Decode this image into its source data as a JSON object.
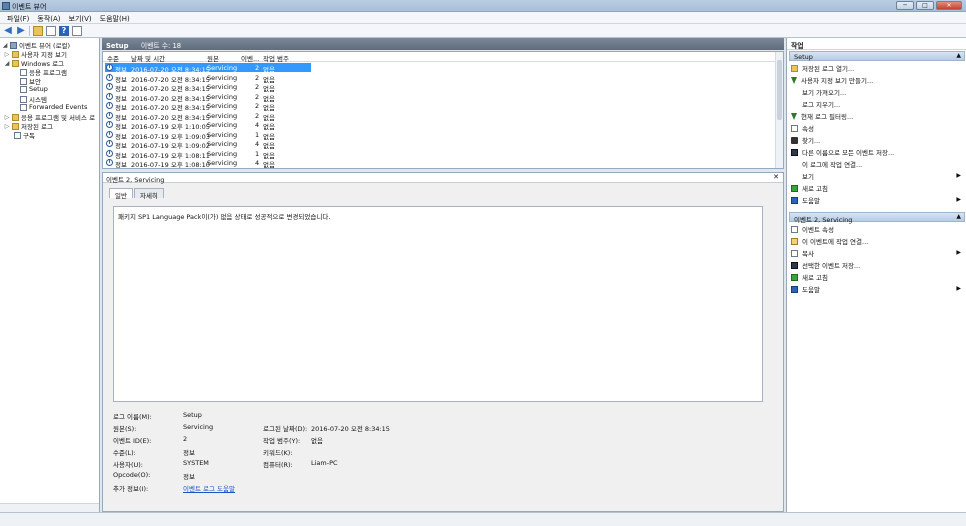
{
  "window": {
    "title": "이벤트 뷰어",
    "minimize": "─",
    "maximize": "□",
    "close": "✕"
  },
  "menu": [
    "파일(F)",
    "동작(A)",
    "보기(V)",
    "도움말(H)"
  ],
  "toolbar": {
    "back": "◀",
    "forward": "▶",
    "help": "?"
  },
  "tree": {
    "root": "이벤트 뷰어 (로컬)",
    "custom_views": "사용자 지정 보기",
    "windows_logs": "Windows 로그",
    "application": "응용 프로그램",
    "security": "보안",
    "setup": "Setup",
    "system": "시스템",
    "forwarded": "Forwarded Events",
    "apps_services": "응용 프로그램 및 서비스 로",
    "saved_logs": "저장된 로그",
    "subscriptions": "구독",
    "expand": "▷",
    "collapse": "◢"
  },
  "center": {
    "log_name": "Setup",
    "event_count": "이벤트 수: 18",
    "columns": [
      "수준",
      "날짜 및 시간",
      "원본",
      "이벤...",
      "작업 범주"
    ],
    "rows": [
      {
        "level": "정보",
        "datetime": "2016-07-20 오전 8:34:15",
        "source": "Servicing",
        "id": "2",
        "category": "없음"
      },
      {
        "level": "정보",
        "datetime": "2016-07-20 오전 8:34:15",
        "source": "Servicing",
        "id": "2",
        "category": "없음"
      },
      {
        "level": "정보",
        "datetime": "2016-07-20 오전 8:34:15",
        "source": "Servicing",
        "id": "2",
        "category": "없음"
      },
      {
        "level": "정보",
        "datetime": "2016-07-20 오전 8:34:15",
        "source": "Servicing",
        "id": "2",
        "category": "없음"
      },
      {
        "level": "정보",
        "datetime": "2016-07-20 오전 8:34:15",
        "source": "Servicing",
        "id": "2",
        "category": "없음"
      },
      {
        "level": "정보",
        "datetime": "2016-07-20 오전 8:34:15",
        "source": "Servicing",
        "id": "2",
        "category": "없음"
      },
      {
        "level": "정보",
        "datetime": "2016-07-19 오후 1:10:05",
        "source": "Servicing",
        "id": "4",
        "category": "없음"
      },
      {
        "level": "정보",
        "datetime": "2016-07-19 오후 1:09:03",
        "source": "Servicing",
        "id": "1",
        "category": "없음"
      },
      {
        "level": "정보",
        "datetime": "2016-07-19 오후 1:09:02",
        "source": "Servicing",
        "id": "4",
        "category": "없음"
      },
      {
        "level": "정보",
        "datetime": "2016-07-19 오후 1:08:11",
        "source": "Servicing",
        "id": "1",
        "category": "없음"
      },
      {
        "level": "정보",
        "datetime": "2016-07-19 오후 1:08:10",
        "source": "Servicing",
        "id": "4",
        "category": "없음"
      }
    ],
    "info_glyph": "i"
  },
  "detail": {
    "title": "이벤트 2, Servicing",
    "close": "✕",
    "tabs": [
      "일반",
      "자세히"
    ],
    "message": "패키지 SP1 Language Pack이(가) 없음 상태로 성공적으로 변경되었습니다.",
    "labels": {
      "log_name": "로그 이름(M):",
      "source": "원본(S):",
      "event_id": "이벤트 ID(E):",
      "level": "수준(L):",
      "user": "사용자(U):",
      "opcode": "Opcode(O):",
      "more_info": "추가 정보(I):",
      "logged": "로그된 날짜(D):",
      "task_category": "작업 범주(Y):",
      "keywords": "키워드(K):",
      "computer": "컴퓨터(R):"
    },
    "values": {
      "log_name": "Setup",
      "source": "Servicing",
      "event_id": "2",
      "level": "정보",
      "user": "SYSTEM",
      "opcode": "정보",
      "more_info": "이벤트 로그 도움말",
      "logged": "2016-07-20 오전 8:34:15",
      "task_category": "없음",
      "keywords": "",
      "computer": "Liam-PC"
    }
  },
  "actions": {
    "title": "작업",
    "section1": "Setup",
    "section1_items": [
      "저장된 로그 열기...",
      "사용자 지정 보기 만들기...",
      "보기 가져오기...",
      "로그 지우기...",
      "현재 로그 필터링...",
      "속성",
      "찾기...",
      "다른 이름으로 모든 이벤트 저장...",
      "이 로그에 작업 연결...",
      "보기",
      "새로 고침",
      "도움말"
    ],
    "section2": "이벤트 2, Servicing",
    "section2_items": [
      "이벤트 속성",
      "이 이벤트에 작업 연결...",
      "복사",
      "선택한 이벤트 저장...",
      "새로 고침",
      "도움말"
    ],
    "collapse_glyph": "▲",
    "submenu_glyph": "▶"
  }
}
